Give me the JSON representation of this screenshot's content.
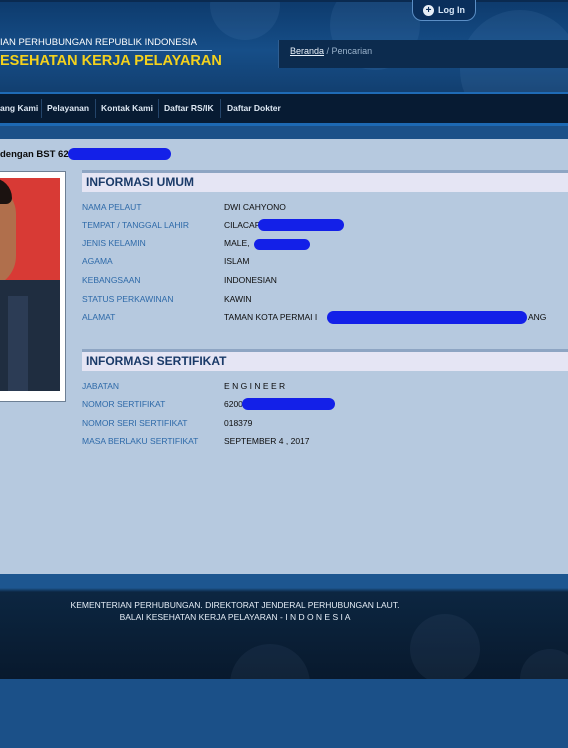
{
  "header": {
    "login_label": "Log In",
    "org_line1": "IAN PERHUBUNGAN REPUBLIK INDONESIA",
    "org_line2": "ESEHATAN KERJA PELAYARAN"
  },
  "breadcrumb": {
    "home": "Beranda",
    "separator": " / ",
    "current": "Pencarian"
  },
  "nav": {
    "items": [
      "ang Kami",
      "Pelayanan",
      "Kontak Kami",
      "Daftar RS/IK",
      "Daftar Dokter"
    ]
  },
  "page": {
    "heading": "dengan BST 62"
  },
  "info_umum": {
    "title": "INFORMASI UMUM",
    "fields": [
      {
        "label": "NAMA PELAUT",
        "value": "DWI CAHYONO"
      },
      {
        "label": "TEMPAT / TANGGAL LAHIR",
        "value": "CILACAP"
      },
      {
        "label": "JENIS KELAMIN",
        "value": "MALE, "
      },
      {
        "label": "AGAMA",
        "value": "ISLAM"
      },
      {
        "label": "KEBANGSAAN",
        "value": "INDONESIAN"
      },
      {
        "label": "STATUS PERKAWINAN",
        "value": "KAWIN"
      },
      {
        "label": "ALAMAT",
        "value": "TAMAN KOTA PERMAI I",
        "value_end": "ANG"
      }
    ]
  },
  "info_sertifikat": {
    "title": "INFORMASI SERTIFIKAT",
    "fields": [
      {
        "label": "JABATAN",
        "value": "ENGINEER"
      },
      {
        "label": "NOMOR SERTIFIKAT",
        "value": "6200"
      },
      {
        "label": "NOMOR SERI SERTIFIKAT",
        "value": "018379"
      },
      {
        "label": "MASA BERLAKU SERTIFIKAT",
        "value": "SEPTEMBER 4 , 2017"
      }
    ]
  },
  "footer": {
    "line1": "KEMENTERIAN PERHUBUNGAN. DIREKTORAT JENDERAL PERHUBUNGAN LAUT.",
    "line2": "BALAI KESEHATAN KERJA PELAYARAN - I N D O N E S I A"
  },
  "colors": {
    "header_blue": "#164e88",
    "nav_dark": "#071b33",
    "content_bg": "#b6c9df",
    "accent_yellow": "#f4d21d",
    "label_blue": "#2d69a8",
    "redaction_blue": "#1320e8"
  }
}
